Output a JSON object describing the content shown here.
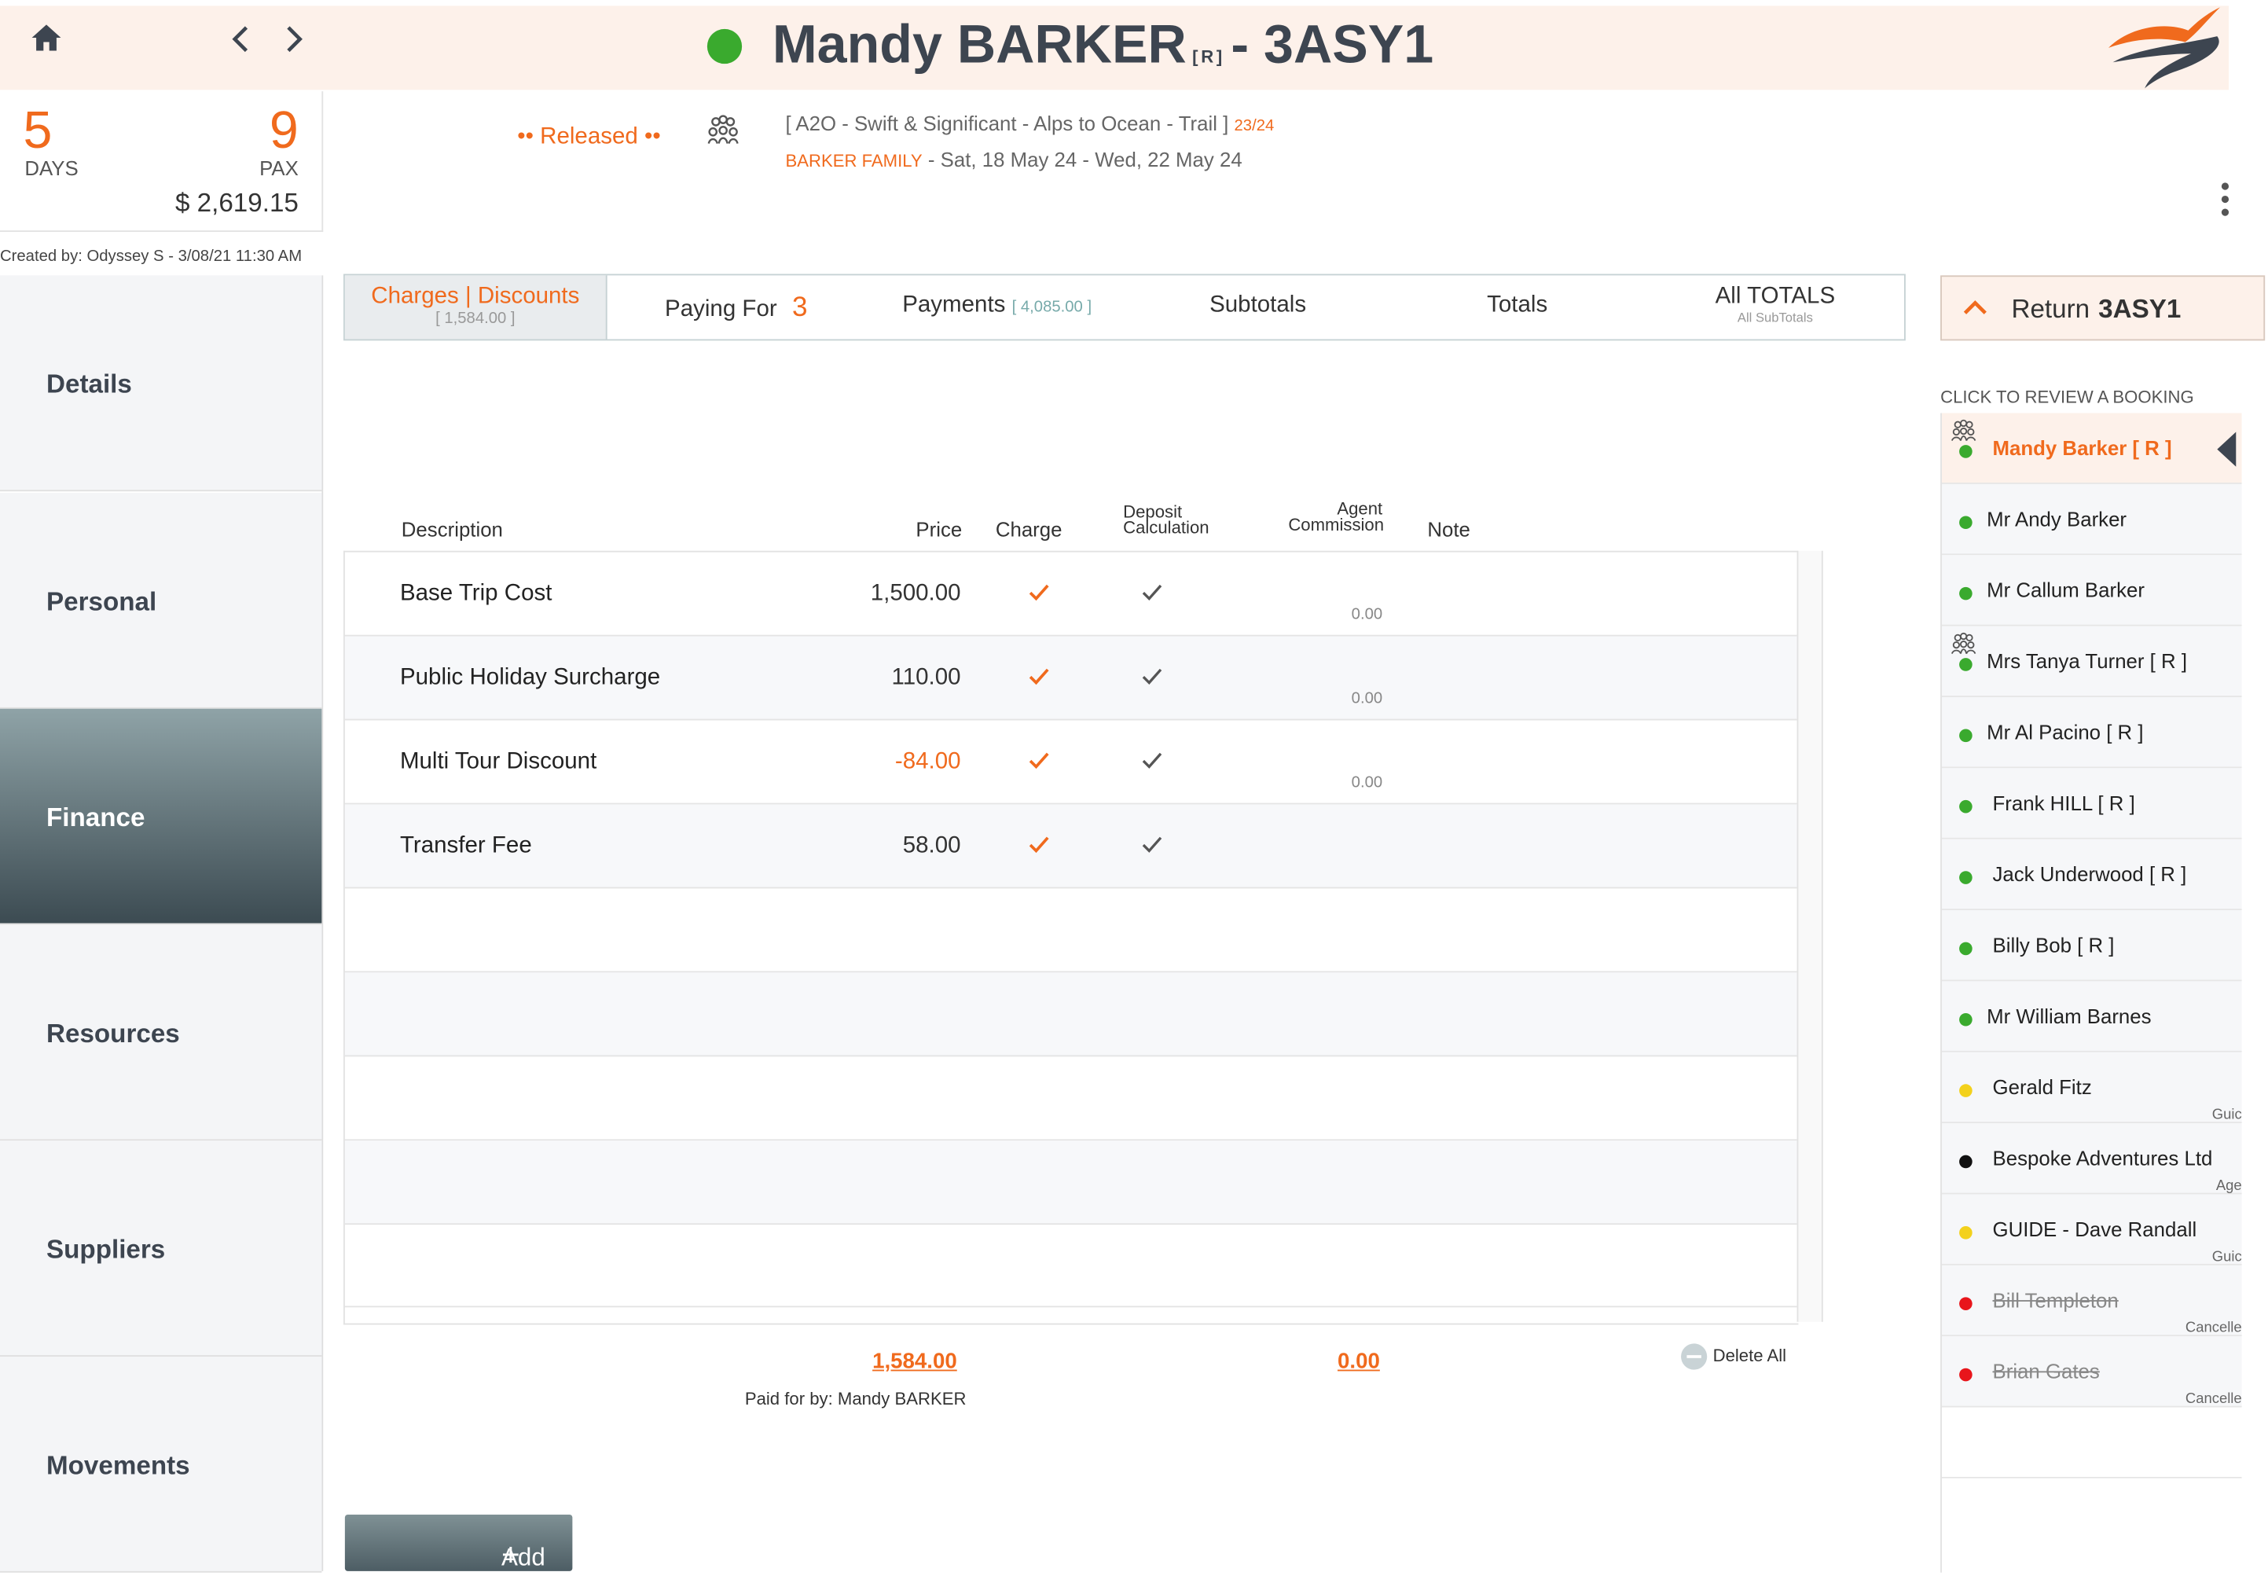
{
  "header": {
    "title_name": "Mandy BARKER",
    "title_r": "[R]",
    "title_code": "- 3ASY1",
    "status_color": "#3aaa2e",
    "accent": "#f06a1d"
  },
  "summary": {
    "days": "5",
    "days_label": "DAYS",
    "pax": "9",
    "pax_label": "PAX",
    "price": "$ 2,619.15",
    "created": "Created by: Odyssey S - 3/08/21 11:30 AM"
  },
  "trip": {
    "released": "•• Released ••",
    "line1": "[ A2O - Swift & Significant - Alps to Ocean - Trail ]",
    "line1_count": "23/24",
    "family": "BARKER FAMILY",
    "dates": " - Sat, 18 May 24 - Wed, 22 May 24"
  },
  "nav": [
    "Details",
    "Personal",
    "Finance",
    "Resources",
    "Suppliers",
    "Movements"
  ],
  "tabs": {
    "charges": "Charges | Discounts",
    "charges_sub": "[ 1,584.00 ]",
    "paying": "Paying For",
    "paying_count": "3",
    "payments": "Payments",
    "payments_sub": "[ 4,085.00 ]",
    "subtotals": "Subtotals",
    "totals": "Totals",
    "all_totals": "All TOTALS",
    "all_sub": "All SubTotals"
  },
  "return_btn": {
    "label": "Return",
    "code": "3ASY1"
  },
  "columns": {
    "description": "Description",
    "price": "Price",
    "charge": "Charge",
    "deposit1": "Deposit",
    "deposit2": "Calculation",
    "agent1": "Agent",
    "agent2": "Commission",
    "note": "Note"
  },
  "rows": [
    {
      "desc": "Base Trip Cost",
      "price": "1,500.00",
      "comm": "0.00"
    },
    {
      "desc": "Public Holiday Surcharge",
      "price": "110.00",
      "comm": "0.00"
    },
    {
      "desc": "Multi Tour Discount",
      "price": "-84.00",
      "comm": "0.00"
    },
    {
      "desc": "Transfer Fee",
      "price": "58.00",
      "comm": ""
    }
  ],
  "footer": {
    "total": "1,584.00",
    "commission_total": "0.00",
    "paid_by": "Paid for by: Mandy BARKER",
    "delete_all": "Delete All",
    "add": "Add"
  },
  "bookings": {
    "label": "CLICK TO REVIEW A BOOKING",
    "items": [
      {
        "name": "Mandy Barker  [ R ]",
        "dot": "#3aaa2e",
        "role": ""
      },
      {
        "name": "Mr Andy Barker",
        "dot": "#3aaa2e",
        "role": ""
      },
      {
        "name": "Mr Callum Barker",
        "dot": "#3aaa2e",
        "role": ""
      },
      {
        "name": "Mrs Tanya Turner  [ R ]",
        "dot": "#3aaa2e",
        "role": ""
      },
      {
        "name": "Mr Al Pacino  [ R ]",
        "dot": "#3aaa2e",
        "role": ""
      },
      {
        "name": "Frank HILL  [ R ]",
        "dot": "#3aaa2e",
        "role": ""
      },
      {
        "name": "Jack Underwood  [ R ]",
        "dot": "#3aaa2e",
        "role": ""
      },
      {
        "name": "Billy Bob  [ R ]",
        "dot": "#3aaa2e",
        "role": ""
      },
      {
        "name": "Mr William Barnes",
        "dot": "#3aaa2e",
        "role": ""
      },
      {
        "name": "Gerald Fitz",
        "dot": "#f3d11c",
        "role": "Guic"
      },
      {
        "name": "Bespoke Adventures Ltd",
        "dot": "#111111",
        "role": "Age"
      },
      {
        "name": "GUIDE - Dave Randall",
        "dot": "#f3d11c",
        "role": "Guic"
      },
      {
        "name": "Bill Templeton",
        "dot": "#e8151b",
        "role": "Cancelle"
      },
      {
        "name": "Brian Gates",
        "dot": "#e8151b",
        "role": "Cancelle"
      }
    ]
  }
}
